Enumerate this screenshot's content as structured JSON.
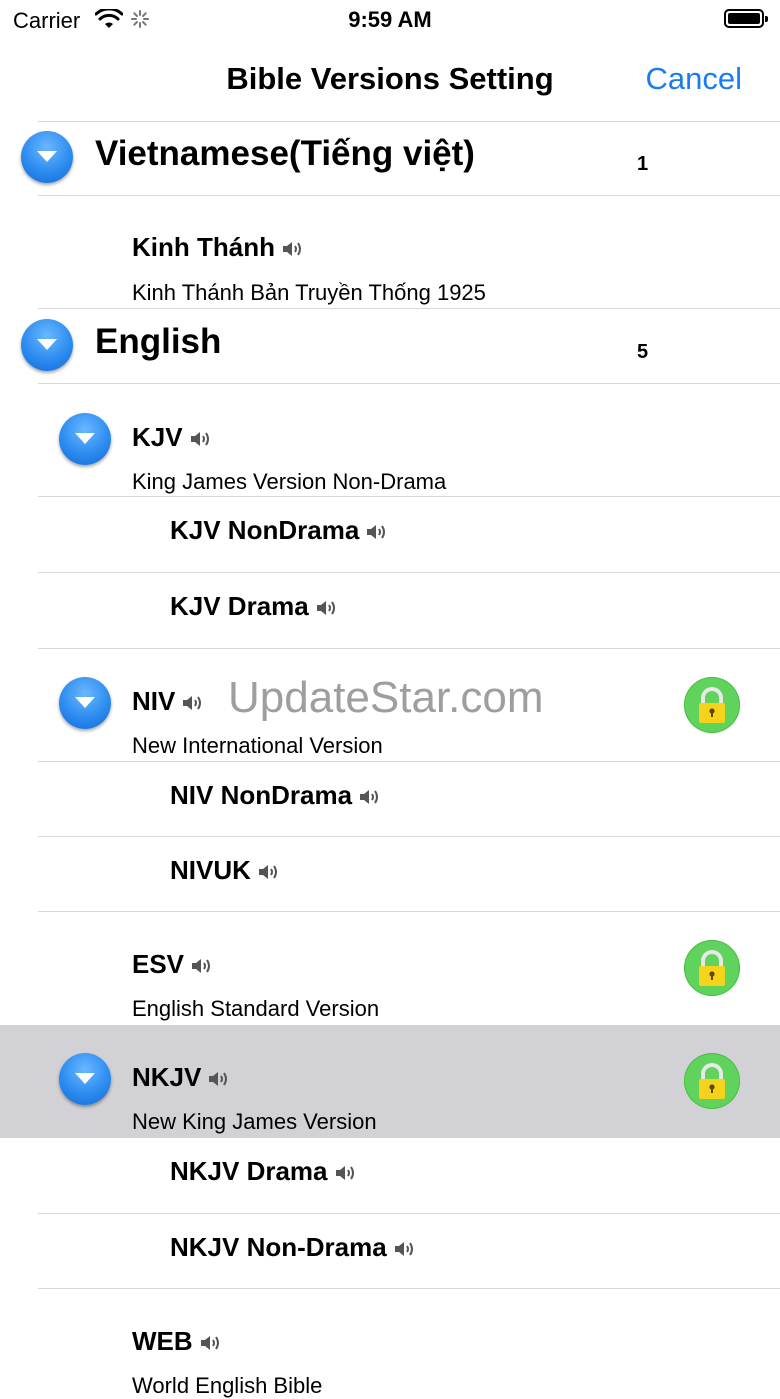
{
  "status_bar": {
    "carrier": "Carrier",
    "time": "9:59 AM"
  },
  "nav": {
    "title": "Bible Versions Setting",
    "cancel": "Cancel"
  },
  "watermark": "UpdateStar.com",
  "groups": [
    {
      "name": "Vietnamese(Tiếng việt)",
      "count": "1",
      "items": [
        {
          "label": "Kinh Thánh",
          "desc": "Kinh Thánh Bản Truyền Thống 1925"
        }
      ]
    },
    {
      "name": "English",
      "count": "5",
      "items": [
        {
          "label": "KJV",
          "desc": "King James Version Non-Drama",
          "subs": [
            {
              "label": "KJV NonDrama"
            },
            {
              "label": "KJV Drama"
            }
          ]
        },
        {
          "label": "NIV",
          "desc": "New International Version",
          "locked": true,
          "subs": [
            {
              "label": "NIV NonDrama"
            },
            {
              "label": "NIVUK"
            }
          ]
        },
        {
          "label": "ESV",
          "desc": "English Standard Version",
          "locked": true
        },
        {
          "label": "NKJV",
          "desc": "New King James Version",
          "locked": true,
          "selected": true,
          "subs": [
            {
              "label": "NKJV Drama"
            },
            {
              "label": "NKJV Non-Drama"
            }
          ]
        },
        {
          "label": "WEB",
          "desc": "World English Bible"
        }
      ]
    }
  ],
  "icons": {
    "expand": "chevron-down-circle-icon",
    "audio": "speaker-icon",
    "lock": "lock-icon"
  },
  "colors": {
    "accent": "#1a7cf5",
    "lock_bg": "#5fd35b",
    "lock_body": "#f5d21b",
    "selected_row": "#d2d2d6"
  }
}
